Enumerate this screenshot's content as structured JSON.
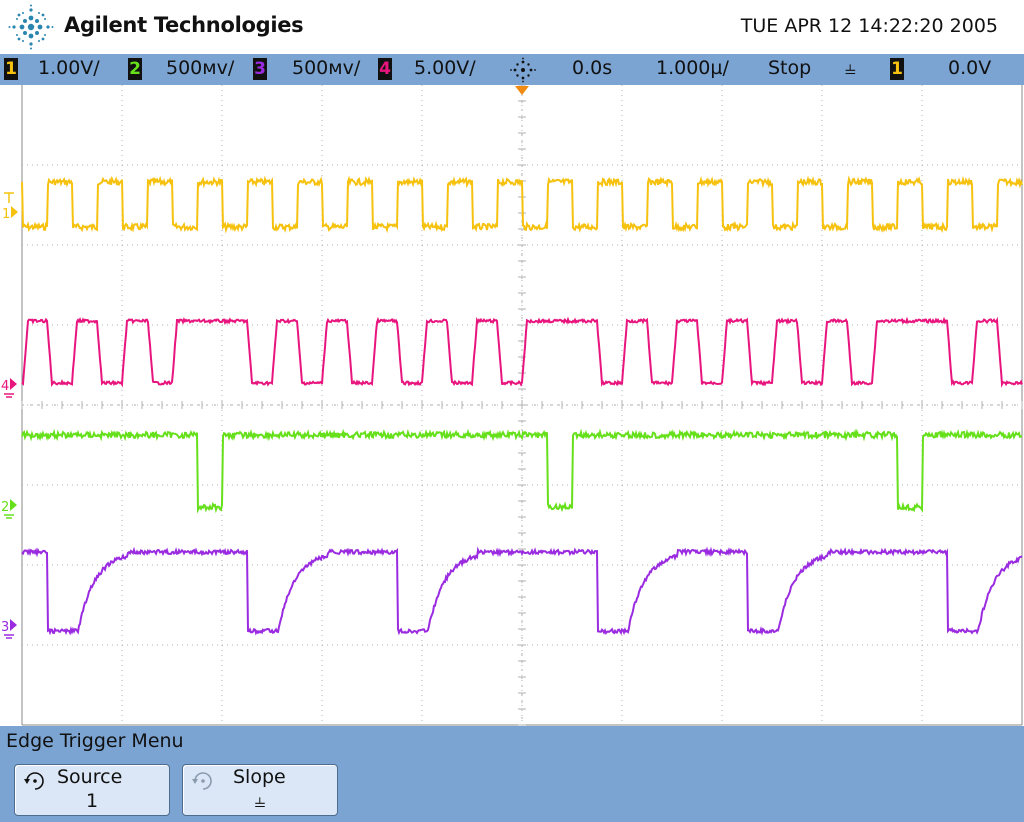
{
  "header": {
    "brand": "Agilent Technologies",
    "datetime": "TUE APR 12 14:22:20 2005"
  },
  "status_bar": {
    "channels": [
      {
        "num": "1",
        "scale": "1.00V/",
        "color": "#f6c20f"
      },
      {
        "num": "2",
        "scale": "500ᴍᴠ/",
        "color": "#66e01a"
      },
      {
        "num": "3",
        "scale": "500ᴍᴠ/",
        "color": "#9a2be0"
      },
      {
        "num": "4",
        "scale": "5.00V/",
        "color": "#e8157e"
      }
    ],
    "delay": "0.0s",
    "timebase": "1.000µ/",
    "run_state": "Stop",
    "trigger_slope_symbol": "⫨",
    "trigger_source": "1",
    "trigger_level": "0.0V"
  },
  "traces": {
    "ch1_marker": "1",
    "ch2_marker": "2",
    "ch3_marker": "3",
    "ch4_marker": "4"
  },
  "menu": {
    "title": "Edge Trigger Menu",
    "softkeys": [
      {
        "label": "Source",
        "value": "1",
        "icon": "rotate-knob-icon"
      },
      {
        "label": "Slope",
        "value": "⫨",
        "icon": "rotate-knob-icon"
      }
    ]
  },
  "colors": {
    "ch1": "#f6c20f",
    "ch2": "#66e01a",
    "ch3": "#9a2be0",
    "ch4": "#e8157e",
    "bar": "#7ba4d2",
    "grid": "#b0b0b0",
    "trigger_marker": "#f08a10"
  }
}
